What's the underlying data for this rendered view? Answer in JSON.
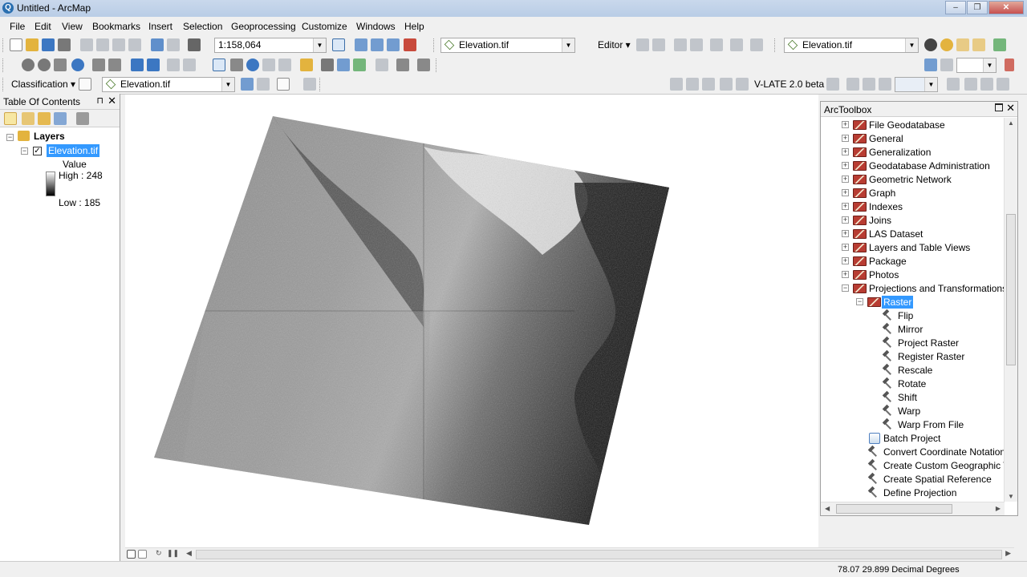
{
  "window": {
    "title": "Untitled - ArcMap",
    "minimize": "–",
    "restore": "❐",
    "close": "✕"
  },
  "menu": [
    "File",
    "Edit",
    "View",
    "Bookmarks",
    "Insert",
    "Selection",
    "Geoprocessing",
    "Customize",
    "Windows",
    "Help"
  ],
  "standard_toolbar": {
    "scale": "1:158,064",
    "layer_combo": "Elevation.tif",
    "editor_label": "Editor ▾",
    "layer_combo2": "Elevation.tif"
  },
  "classification_toolbar": {
    "label": "Classification ▾",
    "layer_combo": "Elevation.tif",
    "plugin_label": "V-LATE 2.0 beta"
  },
  "toc": {
    "title": "Table Of Contents",
    "pin": "⊓",
    "close": "✕",
    "root": "Layers",
    "layer": "Elevation.tif",
    "legend_heading": "Value",
    "high": "High : 248",
    "low": "Low : 185"
  },
  "arctoolbox": {
    "title": "ArcToolbox",
    "close": "✕",
    "toolsets": [
      "File Geodatabase",
      "General",
      "Generalization",
      "Geodatabase Administration",
      "Geometric Network",
      "Graph",
      "Indexes",
      "Joins",
      "LAS Dataset",
      "Layers and Table Views",
      "Package",
      "Photos",
      "Projections and Transformations"
    ],
    "selected_toolset": "Raster",
    "raster_tools": [
      "Flip",
      "Mirror",
      "Project Raster",
      "Register Raster",
      "Rescale",
      "Rotate",
      "Shift",
      "Warp",
      "Warp From File"
    ],
    "other_tools": [
      "Batch Project",
      "Convert Coordinate Notation",
      "Create Custom Geographic Tra",
      "Create Spatial Reference",
      "Define Projection"
    ]
  },
  "status": {
    "coordinates": "78.07  29.899 Decimal Degrees"
  },
  "colors": {
    "selection": "#3399ff",
    "toolbox_red": "#b83c32"
  }
}
